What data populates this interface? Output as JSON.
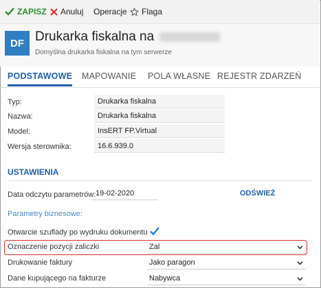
{
  "toolbar": {
    "save_label": "ZAPISZ",
    "cancel_label": "Anuluj",
    "operations_label": "Operacje",
    "flag_label": "Flaga"
  },
  "header": {
    "avatar_text": "DF",
    "title": "Drukarka fiskalna na",
    "subtitle": "Domyślna drukarka fiskalna na tym serwerze"
  },
  "tabs": [
    {
      "label": "PODSTAWOWE",
      "active": true
    },
    {
      "label": "MAPOWANIE",
      "active": false
    },
    {
      "label": "POLA WŁASNE",
      "active": false
    },
    {
      "label": "REJESTR ZDARZEŃ",
      "active": false
    }
  ],
  "fields": [
    {
      "label": "Typ:",
      "value": "Drukarka fiskalna"
    },
    {
      "label": "Nazwa:",
      "value": "Drukarka fiskalna"
    },
    {
      "label": "Model:",
      "value": "InsERT FP.Virtual"
    },
    {
      "label": "Wersja sterownika:",
      "value": "16.6.939.0"
    }
  ],
  "settings": {
    "section_title": "USTAWIENIA",
    "read_date_label": "Data odczytu parametrów:",
    "read_date_value": "19-02-2020",
    "refresh_label": "ODŚWIEŻ",
    "business_params_label": "Parametry biznesowe:",
    "drawer_label": "Otwarcie szuflady po wydruku dokumentu",
    "drawer_checked": true,
    "advance_label": "Oznaczenie pozycji zaliczki",
    "advance_value": "Zal",
    "invoice_print_label": "Drukowanie faktury",
    "invoice_print_value": "Jako paragon",
    "buyer_data_label": "Dane kupującego na fakturze",
    "buyer_data_value": "Nabywca"
  },
  "colors": {
    "accent": "#1f5fa8",
    "save_green": "#2e8b2e",
    "cancel_red": "#d93030",
    "highlight_red": "#d93030",
    "avatar_bg": "#2f7ec1"
  }
}
